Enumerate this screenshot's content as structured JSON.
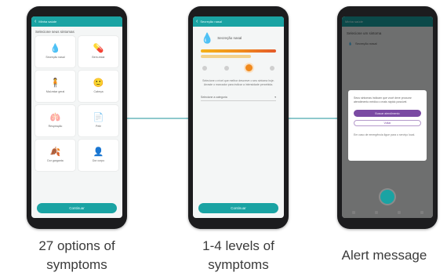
{
  "colors": {
    "teal": "#1aa3a3",
    "purple": "#7a4aa3",
    "orange": "#f08a1e",
    "yellow": "#f0b400",
    "phone": "#1c1c1e"
  },
  "phone1": {
    "title": "Minha saúde",
    "subtitle": "Selecione seus sintomas",
    "tiles": [
      {
        "icon": "drop-icon",
        "glyph": "💧",
        "label": "Secreção nasal"
      },
      {
        "icon": "pill-icon",
        "glyph": "💊",
        "label": "Bem-estar"
      },
      {
        "icon": "person-icon",
        "glyph": "🧍",
        "label": "Mal-estar geral"
      },
      {
        "icon": "face-icon",
        "glyph": "🙂",
        "label": "Cabeça"
      },
      {
        "icon": "lungs-icon",
        "glyph": "🫁",
        "label": "Respiração"
      },
      {
        "icon": "note-icon",
        "glyph": "📄",
        "label": "Pele"
      },
      {
        "icon": "throat-icon",
        "glyph": "🍂",
        "label": "Dor garganta"
      },
      {
        "icon": "head-icon",
        "glyph": "👤",
        "label": "Dor corpo"
      }
    ],
    "continue_label": "Continuar"
  },
  "phone2": {
    "title": "Secreção nasal",
    "symptom_title": "Secreção nasal",
    "description": "Selecione o nível que melhor descreve o seu sintoma hoje. Arraste o marcador para indicar a intensidade percebida.",
    "select_label": "Selecione a categoria",
    "continue_label": "Continuar"
  },
  "phone3": {
    "title": "Minha saúde",
    "subtitle": "Selecione um sintoma",
    "row_label": "Secreção nasal",
    "alert_message": "Seus sintomas indicam que você deve procurar atendimento médico o mais rápido possível.",
    "primary_label": "Buscar atendimento",
    "secondary_label": "Voltar",
    "note": "Em caso de emergência ligue para o serviço local."
  },
  "captions": {
    "c1_line1": "27 options of",
    "c1_line2": "symptoms",
    "c2_line1": "1-4 levels of",
    "c2_line2": "symptoms",
    "c3": "Alert message"
  }
}
